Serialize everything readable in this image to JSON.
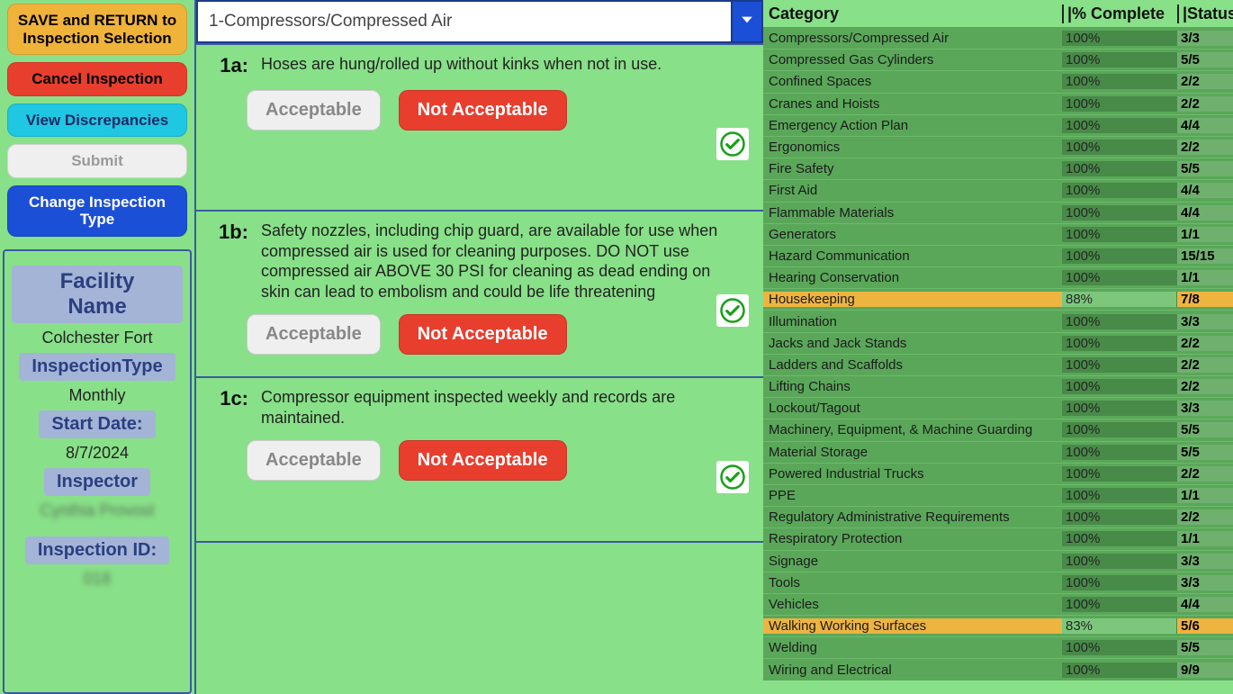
{
  "sidebar": {
    "buttons": {
      "save_return": "SAVE and RETURN to Inspection Selection",
      "cancel": "Cancel Inspection",
      "discrepancies": "View Discrepancies",
      "submit": "Submit",
      "change_type": "Change Inspection Type"
    },
    "info": {
      "facility_label": "Facility Name",
      "facility_value": "Colchester Fort",
      "itype_label": "InspectionType",
      "itype_value": "Monthly",
      "start_label": "Start Date:",
      "start_value": "8/7/2024",
      "inspector_label": "Inspector",
      "inspector_value": "Cynthia Provost",
      "iid_label": "Inspection ID:",
      "iid_value": "018"
    }
  },
  "main": {
    "dropdown_selected": "1-Compressors/Compressed Air",
    "questions": [
      {
        "num": "1a:",
        "text": "Hoses are hung/rolled up without kinks when not in use.",
        "acceptable": "Acceptable",
        "not_acceptable": "Not Acceptable"
      },
      {
        "num": "1b:",
        "text": "Safety nozzles, including chip guard, are available for use when compressed air is used for cleaning purposes. DO NOT use compressed air ABOVE 30 PSI for cleaning as dead ending on skin can lead to embolism and could be life threatening",
        "acceptable": "Acceptable",
        "not_acceptable": "Not Acceptable"
      },
      {
        "num": "1c:",
        "text": "Compressor equipment inspected weekly and records are maintained.",
        "acceptable": "Acceptable",
        "not_acceptable": "Not Acceptable"
      }
    ]
  },
  "right": {
    "headers": {
      "cat": "Category",
      "pct": "% Complete",
      "status": "Status"
    },
    "rows": [
      {
        "cat": "Compressors/Compressed Air",
        "pct": "100%",
        "status": "3/3",
        "state": "green"
      },
      {
        "cat": "Compressed Gas Cylinders",
        "pct": "100%",
        "status": "5/5",
        "state": "green"
      },
      {
        "cat": "Confined Spaces",
        "pct": "100%",
        "status": "2/2",
        "state": "green"
      },
      {
        "cat": "Cranes and Hoists",
        "pct": "100%",
        "status": "2/2",
        "state": "green"
      },
      {
        "cat": "Emergency Action Plan",
        "pct": "100%",
        "status": "4/4",
        "state": "green"
      },
      {
        "cat": "Ergonomics",
        "pct": "100%",
        "status": "2/2",
        "state": "green"
      },
      {
        "cat": "Fire Safety",
        "pct": "100%",
        "status": "5/5",
        "state": "green"
      },
      {
        "cat": "First Aid",
        "pct": "100%",
        "status": "4/4",
        "state": "green"
      },
      {
        "cat": "Flammable Materials",
        "pct": "100%",
        "status": "4/4",
        "state": "green"
      },
      {
        "cat": "Generators",
        "pct": "100%",
        "status": "1/1",
        "state": "green"
      },
      {
        "cat": "Hazard Communication",
        "pct": "100%",
        "status": "15/15",
        "state": "green"
      },
      {
        "cat": "Hearing Conservation",
        "pct": "100%",
        "status": "1/1",
        "state": "green"
      },
      {
        "cat": "Housekeeping",
        "pct": "88%",
        "status": "7/8",
        "state": "orange"
      },
      {
        "cat": "Illumination",
        "pct": "100%",
        "status": "3/3",
        "state": "green"
      },
      {
        "cat": "Jacks and Jack Stands",
        "pct": "100%",
        "status": "2/2",
        "state": "green"
      },
      {
        "cat": "Ladders and Scaffolds",
        "pct": "100%",
        "status": "2/2",
        "state": "green"
      },
      {
        "cat": "Lifting Chains",
        "pct": "100%",
        "status": "2/2",
        "state": "green"
      },
      {
        "cat": "Lockout/Tagout",
        "pct": "100%",
        "status": "3/3",
        "state": "green"
      },
      {
        "cat": "Machinery, Equipment, & Machine Guarding",
        "pct": "100%",
        "status": "5/5",
        "state": "green"
      },
      {
        "cat": "Material Storage",
        "pct": "100%",
        "status": "5/5",
        "state": "green"
      },
      {
        "cat": "Powered Industrial Trucks",
        "pct": "100%",
        "status": "2/2",
        "state": "green"
      },
      {
        "cat": "PPE",
        "pct": "100%",
        "status": "1/1",
        "state": "green"
      },
      {
        "cat": "Regulatory Administrative Requirements",
        "pct": "100%",
        "status": "2/2",
        "state": "green"
      },
      {
        "cat": "Respiratory Protection",
        "pct": "100%",
        "status": "1/1",
        "state": "green"
      },
      {
        "cat": "Signage",
        "pct": "100%",
        "status": "3/3",
        "state": "green"
      },
      {
        "cat": "Tools",
        "pct": "100%",
        "status": "3/3",
        "state": "green"
      },
      {
        "cat": "Vehicles",
        "pct": "100%",
        "status": "4/4",
        "state": "green"
      },
      {
        "cat": "Walking Working Surfaces",
        "pct": "83%",
        "status": "5/6",
        "state": "orange"
      },
      {
        "cat": "Welding",
        "pct": "100%",
        "status": "5/5",
        "state": "green"
      },
      {
        "cat": "Wiring and Electrical",
        "pct": "100%",
        "status": "9/9",
        "state": "green"
      }
    ]
  }
}
